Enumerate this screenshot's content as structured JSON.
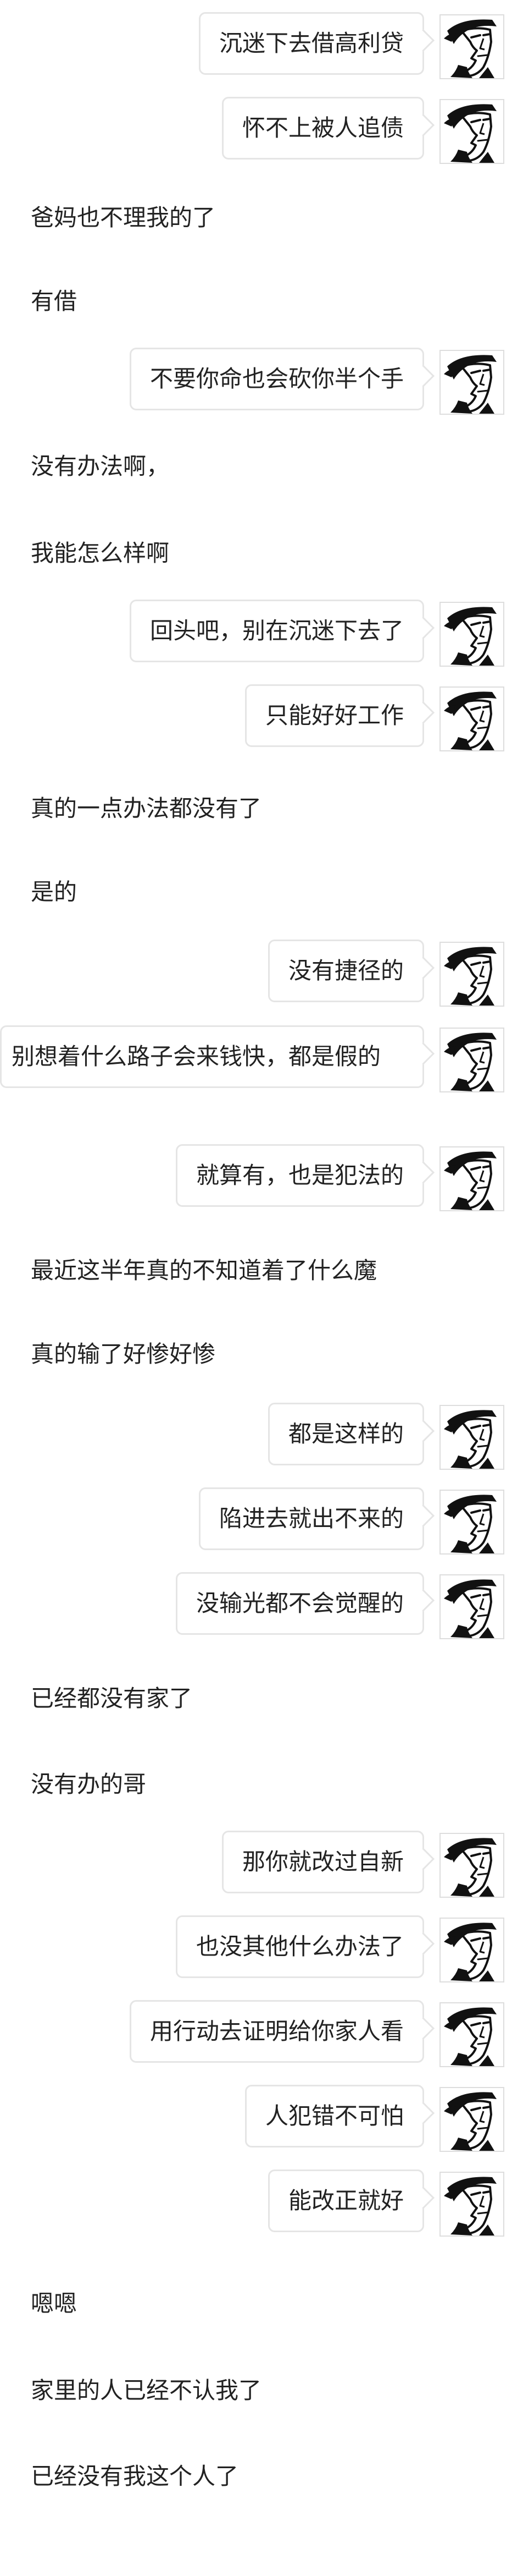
{
  "messages": [
    {
      "side": "out",
      "text": "沉迷下去借高利贷"
    },
    {
      "side": "out",
      "text": "怀不上被人追债"
    },
    {
      "side": "in",
      "text": "爸妈也不理我的了"
    },
    {
      "side": "in",
      "text": "有借"
    },
    {
      "side": "out",
      "text": "不要你命也会砍你半个手"
    },
    {
      "side": "in",
      "text": "没有办法啊，"
    },
    {
      "side": "in",
      "text": "我能怎么样啊"
    },
    {
      "side": "out",
      "text": "回头吧，别在沉迷下去了"
    },
    {
      "side": "out",
      "text": "只能好好工作"
    },
    {
      "side": "in",
      "text": "真的一点办法都没有了"
    },
    {
      "side": "in",
      "text": "是的"
    },
    {
      "side": "out",
      "text": "没有捷径的"
    },
    {
      "side": "out",
      "text": "别想着什么路子会来钱快，都是假的"
    },
    {
      "side": "out",
      "text": "就算有，也是犯法的"
    },
    {
      "side": "in",
      "text": "最近这半年真的不知道着了什么魔"
    },
    {
      "side": "in",
      "text": "真的输了好惨好惨"
    },
    {
      "side": "out",
      "text": "都是这样的"
    },
    {
      "side": "out",
      "text": "陷进去就出不来的"
    },
    {
      "side": "out",
      "text": "没输光都不会觉醒的"
    },
    {
      "side": "in",
      "text": "已经都没有家了"
    },
    {
      "side": "in",
      "text": "没有办的哥"
    },
    {
      "side": "out",
      "text": "那你就改过自新"
    },
    {
      "side": "out",
      "text": "也没其他什么办法了"
    },
    {
      "side": "out",
      "text": "用行动去证明给你家人看"
    },
    {
      "side": "out",
      "text": "人犯错不可怕"
    },
    {
      "side": "out",
      "text": "能改正就好"
    },
    {
      "side": "in",
      "text": "嗯嗯"
    },
    {
      "side": "in",
      "text": "家里的人已经不认我了"
    },
    {
      "side": "in",
      "text": "已经没有我这个人了"
    }
  ],
  "avatar": {
    "icon": "sketch-face-avatar-icon"
  },
  "colors": {
    "background": "#ffffff",
    "bubble_border": "#e5e5e5",
    "text": "#222222"
  }
}
